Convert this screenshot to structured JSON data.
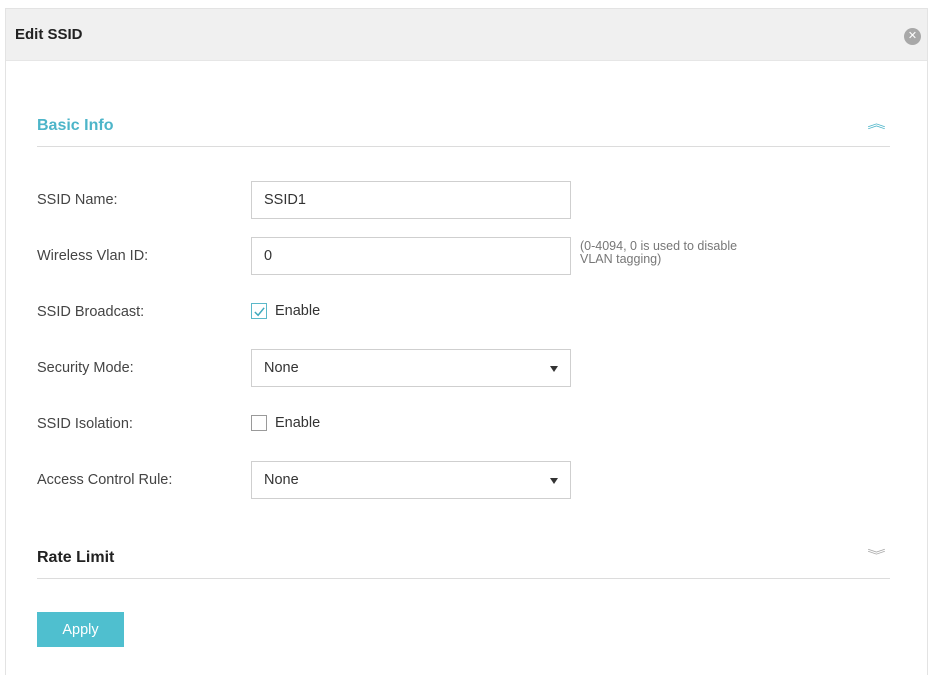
{
  "dialog": {
    "title": "Edit SSID",
    "close_icon": "close-circle-icon"
  },
  "sections": {
    "basic_info": {
      "title": "Basic Info",
      "expanded": true,
      "toggle_icon": "chevron-double-up-icon"
    },
    "rate_limit": {
      "title": "Rate Limit",
      "expanded": false,
      "toggle_icon": "chevron-double-down-icon"
    }
  },
  "form": {
    "ssid_name": {
      "label": "SSID Name:",
      "value": "SSID1"
    },
    "wireless_vlan_id": {
      "label": "Wireless Vlan ID:",
      "value": "0",
      "hint_line1": "(0-4094, 0 is used to disable",
      "hint_line2": "VLAN tagging)"
    },
    "ssid_broadcast": {
      "label": "SSID Broadcast:",
      "option_label": "Enable",
      "checked": true
    },
    "security_mode": {
      "label": "Security Mode:",
      "selected": "None"
    },
    "ssid_isolation": {
      "label": "SSID Isolation:",
      "option_label": "Enable",
      "checked": false
    },
    "access_control_rule": {
      "label": "Access Control Rule:",
      "selected": "None"
    }
  },
  "actions": {
    "apply_label": "Apply"
  },
  "colors": {
    "accent": "#4db5c9",
    "button": "#4fbfcf",
    "header_bg": "#f0f0f0",
    "border": "#cfcfcf"
  }
}
